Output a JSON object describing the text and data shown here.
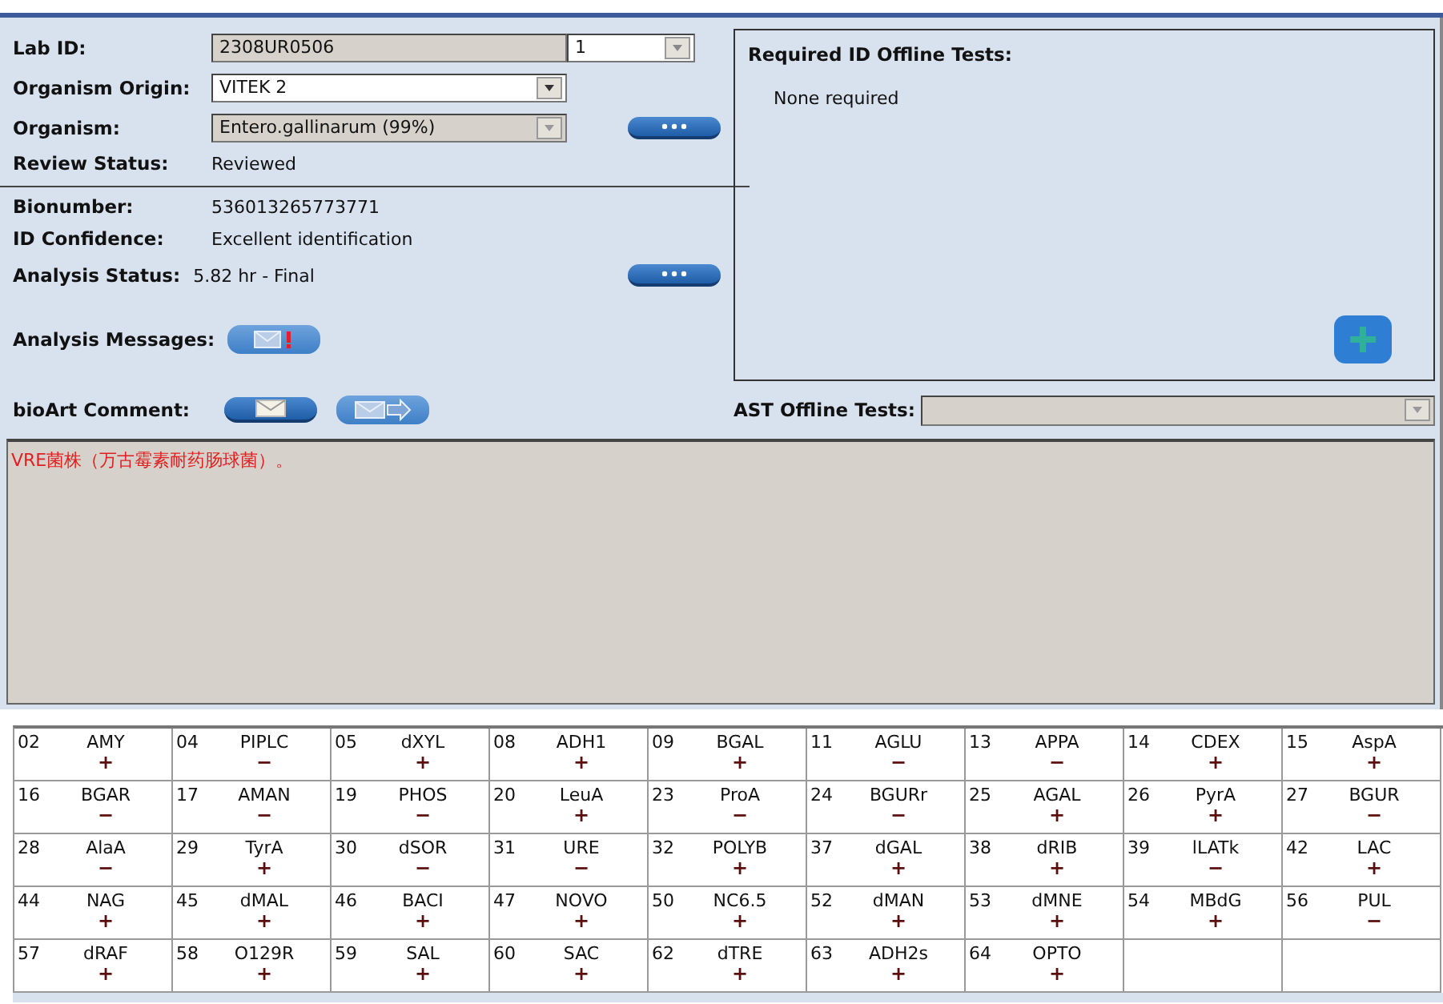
{
  "lab_id": {
    "label": "Lab ID:",
    "value": "2308UR0506",
    "isolate": "1"
  },
  "organism_origin": {
    "label": "Organism Origin:",
    "value": "VITEK 2",
    "disabled": false
  },
  "organism": {
    "label": "Organism:",
    "value": "Entero.gallinarum (99%)",
    "disabled": true
  },
  "review_status": {
    "label": "Review Status:",
    "value": "Reviewed"
  },
  "bionumber": {
    "label": "Bionumber:",
    "value": "536013265773771"
  },
  "id_confidence": {
    "label": "ID Confidence:",
    "value": "Excellent identification"
  },
  "analysis_status": {
    "label": "Analysis Status:",
    "value": "5.82 hr - Final"
  },
  "analysis_messages": {
    "label": "Analysis Messages:"
  },
  "bioart_comment": {
    "label": "bioArt Comment:",
    "text": "VRE菌株（万古霉素耐药肠球菌）。"
  },
  "required_id_offline_tests": {
    "title": "Required ID Offline Tests:",
    "text": "None required"
  },
  "ast_offline_tests": {
    "label": "AST Offline Tests:"
  },
  "tests": [
    [
      {
        "number": "02",
        "name": "AMY",
        "result": "+"
      },
      {
        "number": "04",
        "name": "PIPLC",
        "result": "−"
      },
      {
        "number": "05",
        "name": "dXYL",
        "result": "+"
      },
      {
        "number": "08",
        "name": "ADH1",
        "result": "+"
      },
      {
        "number": "09",
        "name": "BGAL",
        "result": "+"
      },
      {
        "number": "11",
        "name": "AGLU",
        "result": "−"
      },
      {
        "number": "13",
        "name": "APPA",
        "result": "−"
      },
      {
        "number": "14",
        "name": "CDEX",
        "result": "+"
      },
      {
        "number": "15",
        "name": "AspA",
        "result": "+"
      }
    ],
    [
      {
        "number": "16",
        "name": "BGAR",
        "result": "−"
      },
      {
        "number": "17",
        "name": "AMAN",
        "result": "−"
      },
      {
        "number": "19",
        "name": "PHOS",
        "result": "−"
      },
      {
        "number": "20",
        "name": "LeuA",
        "result": "+"
      },
      {
        "number": "23",
        "name": "ProA",
        "result": "−"
      },
      {
        "number": "24",
        "name": "BGURr",
        "result": "−"
      },
      {
        "number": "25",
        "name": "AGAL",
        "result": "+"
      },
      {
        "number": "26",
        "name": "PyrA",
        "result": "+"
      },
      {
        "number": "27",
        "name": "BGUR",
        "result": "−"
      }
    ],
    [
      {
        "number": "28",
        "name": "AlaA",
        "result": "−"
      },
      {
        "number": "29",
        "name": "TyrA",
        "result": "+"
      },
      {
        "number": "30",
        "name": "dSOR",
        "result": "−"
      },
      {
        "number": "31",
        "name": "URE",
        "result": "−"
      },
      {
        "number": "32",
        "name": "POLYB",
        "result": "+"
      },
      {
        "number": "37",
        "name": "dGAL",
        "result": "+"
      },
      {
        "number": "38",
        "name": "dRIB",
        "result": "+"
      },
      {
        "number": "39",
        "name": "lLATk",
        "result": "−"
      },
      {
        "number": "42",
        "name": "LAC",
        "result": "+"
      }
    ],
    [
      {
        "number": "44",
        "name": "NAG",
        "result": "+"
      },
      {
        "number": "45",
        "name": "dMAL",
        "result": "+"
      },
      {
        "number": "46",
        "name": "BACI",
        "result": "+"
      },
      {
        "number": "47",
        "name": "NOVO",
        "result": "+"
      },
      {
        "number": "50",
        "name": "NC6.5",
        "result": "+"
      },
      {
        "number": "52",
        "name": "dMAN",
        "result": "+"
      },
      {
        "number": "53",
        "name": "dMNE",
        "result": "+"
      },
      {
        "number": "54",
        "name": "MBdG",
        "result": "+"
      },
      {
        "number": "56",
        "name": "PUL",
        "result": "−"
      }
    ],
    [
      {
        "number": "57",
        "name": "dRAF",
        "result": "+"
      },
      {
        "number": "58",
        "name": "O129R",
        "result": "+"
      },
      {
        "number": "59",
        "name": "SAL",
        "result": "+"
      },
      {
        "number": "60",
        "name": "SAC",
        "result": "+"
      },
      {
        "number": "62",
        "name": "dTRE",
        "result": "+"
      },
      {
        "number": "63",
        "name": "ADH2s",
        "result": "+"
      },
      {
        "number": "64",
        "name": "OPTO",
        "result": "+"
      }
    ]
  ]
}
